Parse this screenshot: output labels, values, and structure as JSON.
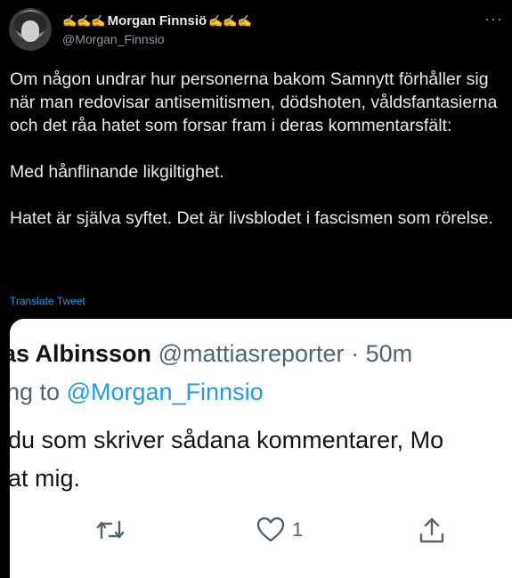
{
  "author": {
    "display_name": "Morgan Finnsiö",
    "name_prefix": "✍✍✍",
    "name_suffix": "✍✍✍",
    "handle": "@Morgan_Finnsio",
    "avatar_icon": "profile-photo"
  },
  "tweet": {
    "text": "Om någon undrar hur personerna bakom Samnytt förhåller sig när man redovisar antisemitismen, dödshoten, våldsfantasierna och det råa hatet som forsar fram i deras kommentarsfält:\n\nMed hånflinande likgiltighet.\n\nHatet är själva syftet. Det är livsblodet i fascismen som rörelse.",
    "translate_label": "Translate Tweet",
    "more_icon": "more-dots-icon"
  },
  "embedded_screenshot": {
    "author_name": "as Albinsson",
    "author_handle": "@mattiasreporter",
    "separator": "·",
    "time": "50m",
    "reply_prefix": "ng to",
    "reply_handle": "@Morgan_Finnsio",
    "line1": "du som skriver sådana kommentarer, Mo",
    "line2": "at mig.",
    "retweet_icon": "retweet-icon",
    "like_icon": "heart-icon",
    "like_count": "1",
    "share_icon": "share-icon"
  },
  "colors": {
    "background": "#000000",
    "text": "#e7e9ea",
    "secondary": "#8b98a5",
    "link": "#1d9bf0"
  }
}
